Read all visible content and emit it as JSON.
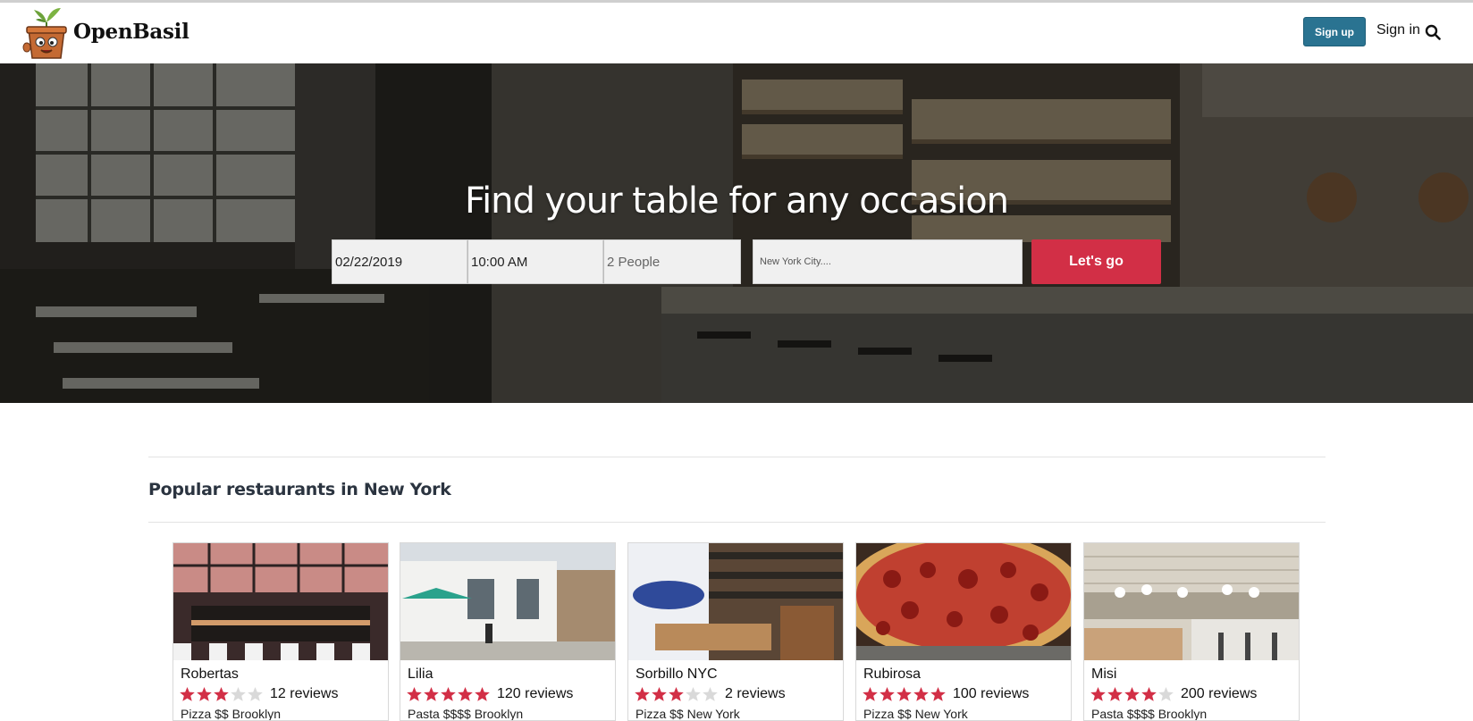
{
  "app": {
    "brand": "OpenBasil"
  },
  "header": {
    "signup_label": "Sign up",
    "signin_label": "Sign in"
  },
  "hero": {
    "title": "Find your table for any occasion",
    "date_value": "02/22/2019",
    "time_value": "10:00 AM",
    "party_value": "2 People",
    "location_placeholder": "New York City....",
    "submit_label": "Let's go"
  },
  "popular": {
    "title": "Popular restaurants in New York",
    "restaurants": [
      {
        "name": "Robertas",
        "rating": 3,
        "reviews": "12 reviews",
        "meta": "Pizza $$ Brooklyn"
      },
      {
        "name": "Lilia",
        "rating": 5,
        "reviews": "120 reviews",
        "meta": "Pasta $$$$ Brooklyn"
      },
      {
        "name": "Sorbillo NYC",
        "rating": 3,
        "reviews": "2 reviews",
        "meta": "Pizza $$ New York"
      },
      {
        "name": "Rubirosa",
        "rating": 5,
        "reviews": "100 reviews",
        "meta": "Pizza $$ New York"
      },
      {
        "name": "Misi",
        "rating": 4,
        "reviews": "200 reviews",
        "meta": "Pasta $$$$ Brooklyn"
      }
    ]
  },
  "colors": {
    "signup": "#2a7391",
    "submit": "#d22f46",
    "star_filled": "#d22f46",
    "star_empty": "#d9d9d9"
  }
}
